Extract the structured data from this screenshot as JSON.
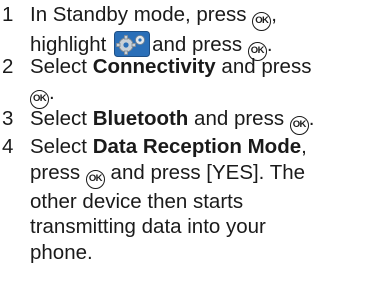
{
  "ok_key_label": "OK",
  "settings_icon": "settings-icon",
  "colors": {
    "text": "#1a1a1a",
    "icon_blue": "#2a6fb8",
    "icon_gray": "#9aa4ad"
  },
  "steps": [
    {
      "number": "1",
      "line1_a": "In Standby mode, press",
      "line1_b": ",",
      "line2_a": "highlight",
      "line2_b": "and press",
      "line2_c": "."
    },
    {
      "number": "2",
      "a": "Select",
      "bold": "Connectivity",
      "b": "and press",
      "c": "."
    },
    {
      "number": "3",
      "a": "Select",
      "bold": "Bluetooth",
      "b": "and press",
      "c": "."
    },
    {
      "number": "4",
      "a": "Select",
      "bold": "Data Reception Mode",
      "b": ",",
      "line2_a": "press",
      "line2_b": "and press [YES]. The",
      "line3": "other device then starts",
      "line4": "transmitting data into your",
      "line5": "phone."
    }
  ]
}
